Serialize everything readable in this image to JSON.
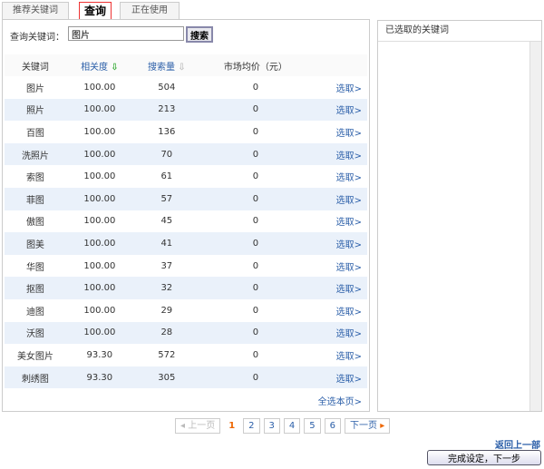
{
  "tabs": [
    {
      "label": "推荐关键词"
    },
    {
      "label": "查询"
    },
    {
      "label": "正在使用"
    }
  ],
  "search": {
    "label": "查询关键词：",
    "value": "图片",
    "button": "搜索"
  },
  "table": {
    "headers": [
      "关键词",
      "相关度",
      "搜索量",
      "市场均价（元）"
    ],
    "sort_icon_active_color": "#3a3",
    "sort_icon_inactive_color": "#aaa",
    "rows": [
      [
        "图片",
        "100.00",
        "504",
        "0"
      ],
      [
        "照片",
        "100.00",
        "213",
        "0"
      ],
      [
        "百图",
        "100.00",
        "136",
        "0"
      ],
      [
        "洗照片",
        "100.00",
        "70",
        "0"
      ],
      [
        "索图",
        "100.00",
        "61",
        "0"
      ],
      [
        "菲图",
        "100.00",
        "57",
        "0"
      ],
      [
        "傲图",
        "100.00",
        "45",
        "0"
      ],
      [
        "图美",
        "100.00",
        "41",
        "0"
      ],
      [
        "华图",
        "100.00",
        "37",
        "0"
      ],
      [
        "抠图",
        "100.00",
        "32",
        "0"
      ],
      [
        "迪图",
        "100.00",
        "29",
        "0"
      ],
      [
        "沃图",
        "100.00",
        "28",
        "0"
      ],
      [
        "美女图片",
        "93.30",
        "572",
        "0"
      ],
      [
        "刺绣图",
        "93.30",
        "305",
        "0"
      ]
    ],
    "pick_label": "选取>",
    "select_all": "全选本页>"
  },
  "selected_panel": {
    "title": "已选取的关键词"
  },
  "pager": {
    "prev": "上一页",
    "pages": [
      "1",
      "2",
      "3",
      "4",
      "5",
      "6"
    ],
    "current": "1",
    "next": "下一页"
  },
  "footer": {
    "back": "返回上一部",
    "next": "完成设定，下一步"
  }
}
